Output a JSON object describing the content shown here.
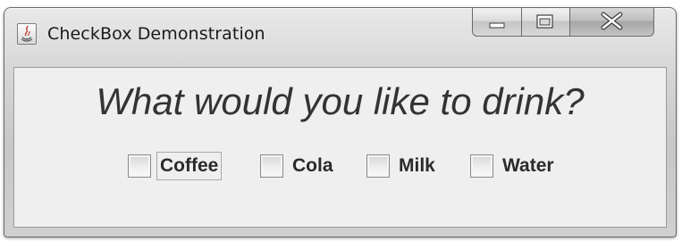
{
  "window": {
    "title": "CheckBox Demonstration",
    "app_icon": "java-cup-icon",
    "caption_buttons": [
      "minimize-icon",
      "maximize-icon",
      "close-icon"
    ]
  },
  "content": {
    "prompt": "What would you like to drink?",
    "checkboxes": [
      {
        "label": "Coffee",
        "checked": false,
        "focused": true
      },
      {
        "label": "Cola",
        "checked": false,
        "focused": false
      },
      {
        "label": "Milk",
        "checked": false,
        "focused": false
      },
      {
        "label": "Water",
        "checked": false,
        "focused": false
      }
    ]
  }
}
